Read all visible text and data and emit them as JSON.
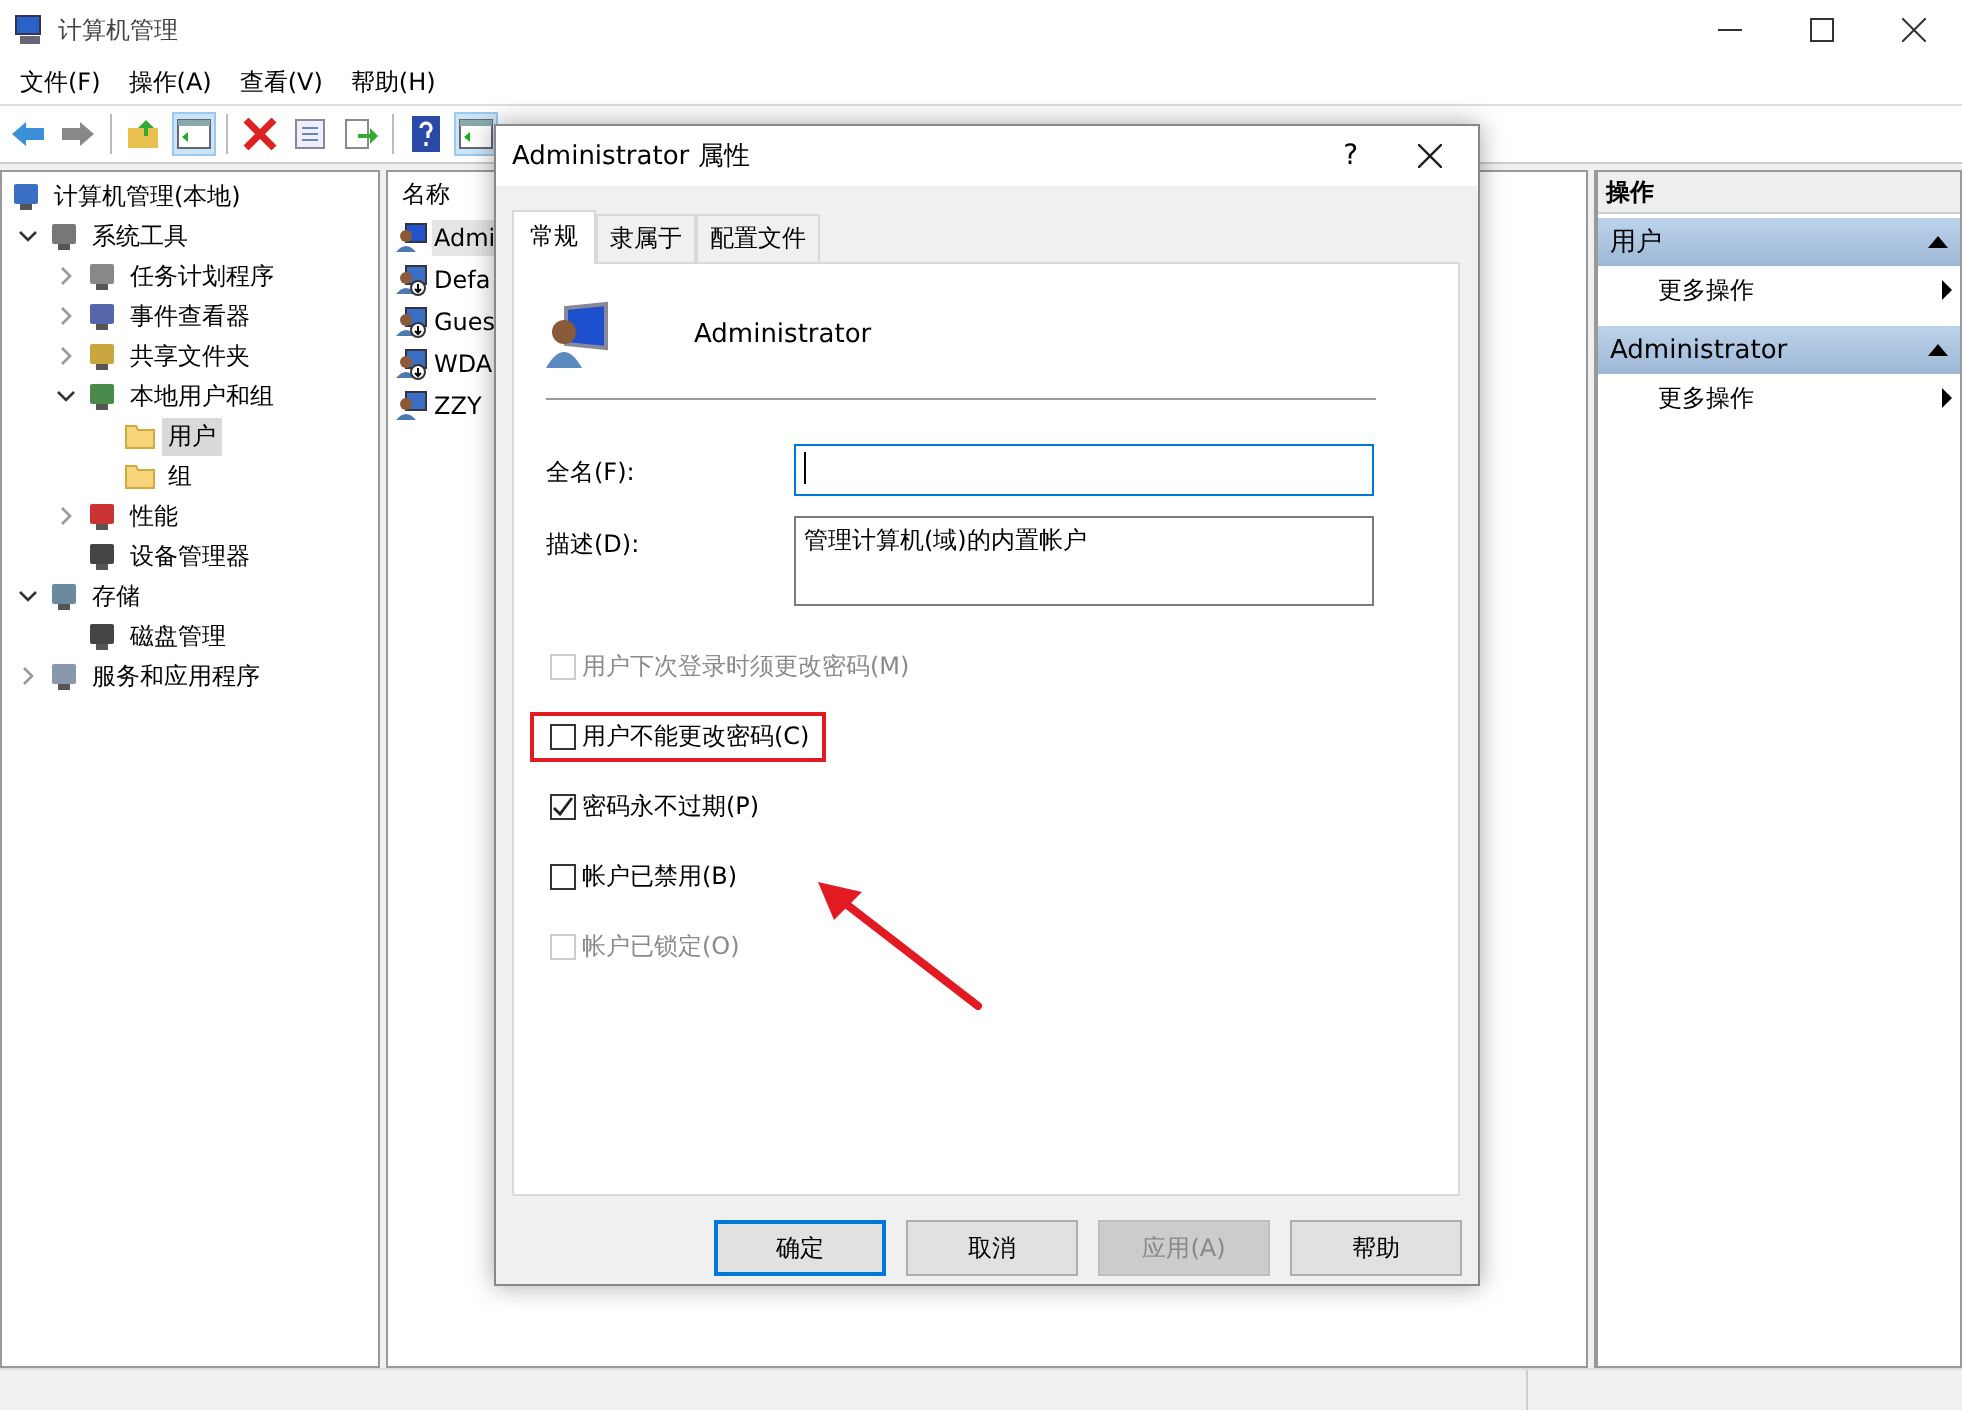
{
  "window": {
    "title": "计算机管理"
  },
  "menu": [
    "文件(F)",
    "操作(A)",
    "查看(V)",
    "帮助(H)"
  ],
  "toolbar": [
    {
      "kind": "back",
      "on": false
    },
    {
      "kind": "forward",
      "on": false
    },
    {
      "kind": "up",
      "on": false
    },
    {
      "kind": "pane",
      "on": true
    },
    {
      "kind": "delete",
      "on": false
    },
    {
      "kind": "properties",
      "on": false
    },
    {
      "kind": "export",
      "on": false
    },
    {
      "kind": "help",
      "on": false
    },
    {
      "kind": "pane",
      "on": true
    }
  ],
  "tree": [
    {
      "label": "计算机管理(本地)",
      "kind": "computer",
      "selected": false,
      "children": [
        {
          "label": "系统工具",
          "kind": "tools",
          "expanded": true,
          "selected": false,
          "children": [
            {
              "label": "任务计划程序",
              "kind": "clock",
              "expanded": false,
              "selected": false
            },
            {
              "label": "事件查看器",
              "kind": "log",
              "expanded": false,
              "selected": false
            },
            {
              "label": "共享文件夹",
              "kind": "share",
              "expanded": false,
              "selected": false
            },
            {
              "label": "本地用户和组",
              "kind": "users",
              "expanded": true,
              "selected": false,
              "children": [
                {
                  "label": "用户",
                  "kind": "folder",
                  "selected": true
                },
                {
                  "label": "组",
                  "kind": "folder",
                  "selected": false
                }
              ]
            },
            {
              "label": "性能",
              "kind": "gauge",
              "expanded": false,
              "selected": false
            },
            {
              "label": "设备管理器",
              "kind": "device",
              "selected": false
            }
          ]
        },
        {
          "label": "存储",
          "kind": "storage",
          "expanded": true,
          "selected": false,
          "children": [
            {
              "label": "磁盘管理",
              "kind": "device",
              "selected": false
            }
          ]
        },
        {
          "label": "服务和应用程序",
          "kind": "services",
          "expanded": false,
          "selected": false
        }
      ]
    }
  ],
  "list": {
    "columns": [
      "名称"
    ],
    "rows": [
      {
        "name": "Admi",
        "kind": "admin",
        "selected": true
      },
      {
        "name": "Defa",
        "kind": "disabled-user",
        "selected": false
      },
      {
        "name": "Gues",
        "kind": "disabled-user",
        "selected": false
      },
      {
        "name": "WDA",
        "kind": "disabled-user",
        "selected": false
      },
      {
        "name": "ZZY",
        "kind": "user",
        "selected": false
      }
    ]
  },
  "actions": {
    "title": "操作",
    "sections": [
      {
        "title": "用户",
        "expanded": true,
        "items": [
          "更多操作"
        ]
      },
      {
        "title": "Administrator",
        "expanded": true,
        "items": [
          "更多操作"
        ]
      }
    ]
  },
  "dialog": {
    "title": "Administrator 属性",
    "help": "?",
    "tabs": [
      {
        "label": "常规",
        "selected": true
      },
      {
        "label": "隶属于",
        "selected": false
      },
      {
        "label": "配置文件",
        "selected": false
      }
    ],
    "user_name": "Administrator",
    "fields": [
      {
        "label": "全名(F):",
        "focused": true
      },
      {
        "label": "描述(D):",
        "value": "管理计算机(域)的内置帐户",
        "focused": false
      }
    ],
    "checkboxes": [
      {
        "label": "用户下次登录时须更改密码(M)",
        "checked": false,
        "disabled": true,
        "highlighted": false
      },
      {
        "label": "用户不能更改密码(C)",
        "checked": false,
        "disabled": false,
        "highlighted": true
      },
      {
        "label": "密码永不过期(P)",
        "checked": true,
        "disabled": false,
        "highlighted": false
      },
      {
        "label": "帐户已禁用(B)",
        "checked": false,
        "disabled": false,
        "highlighted": false
      },
      {
        "label": "帐户已锁定(O)",
        "checked": false,
        "disabled": true,
        "highlighted": false
      }
    ],
    "buttons": [
      {
        "label": "确定",
        "default": true,
        "disabled": false
      },
      {
        "label": "取消",
        "default": false,
        "disabled": false
      },
      {
        "label": "应用(A)",
        "default": false,
        "disabled": true
      },
      {
        "label": "帮助",
        "default": false,
        "disabled": false
      }
    ]
  }
}
